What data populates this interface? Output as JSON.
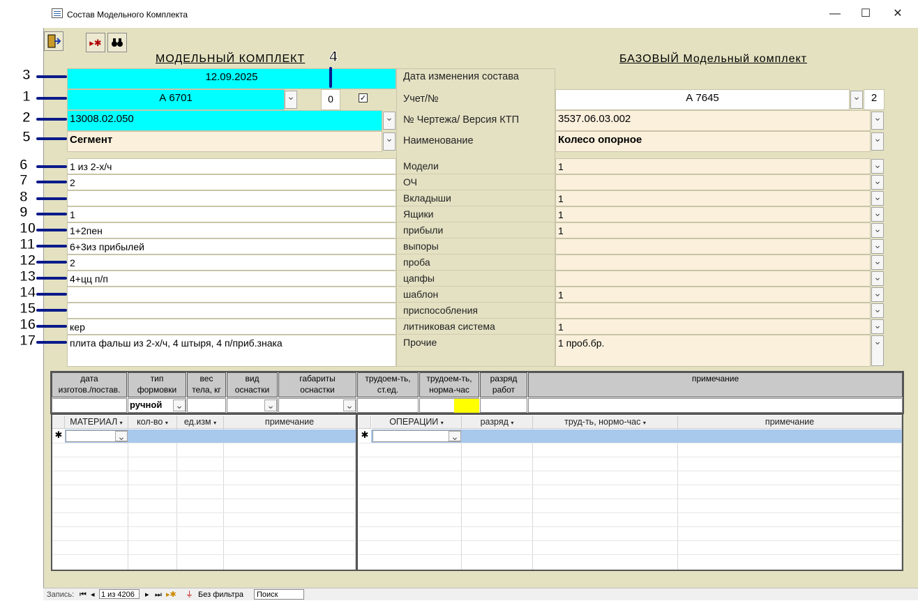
{
  "window": {
    "title": "Состав Модельного Комплекта",
    "minimize": "—",
    "maximize": "☐",
    "close": "✕"
  },
  "toolbar": {
    "exit_icon": "exit-door-icon",
    "new_icon": "new-record-icon",
    "find_icon": "binoculars-icon"
  },
  "headers": {
    "left": "МОДЕЛЬНЫЙ   КОМПЛЕКТ",
    "right": "БАЗОВЫЙ  Модельный комплект"
  },
  "left": {
    "date": "12.09.2025",
    "account": "А 6701",
    "count": "0",
    "drawing": "13008.02.050",
    "name": "Сегмент",
    "models": "1 из 2-х/ч",
    "och": "2",
    "inserts": "",
    "boxes": "1",
    "risers": "1+2пен",
    "vents": "6+3из прибылей",
    "sample": "2",
    "pins": "4+цц п/п",
    "template": "",
    "fixtures": "",
    "gating": "кер",
    "other": "плита фальш из 2-х/ч, 4 штыря, 4 п/приб.знака"
  },
  "labels": {
    "date": "Дата изменения состава",
    "account": "Учет/№",
    "drawing": "№  Чертежа/ Версия КТП",
    "name": "Наименование",
    "models": "Модели",
    "och": "ОЧ",
    "inserts": "Вкладыши",
    "boxes": "Ящики",
    "risers": "прибыли",
    "vents": "выпоры",
    "sample": "проба",
    "pins": "цапфы",
    "template": "шаблон",
    "fixtures": "приспособления",
    "gating": "литниковая система",
    "other": "Прочие"
  },
  "right": {
    "account": "А 7645",
    "account_num": "2",
    "drawing": "3537.06.03.002",
    "name": "Колесо опорное",
    "models": "1",
    "och": "",
    "inserts": "1",
    "boxes": "1",
    "risers": "1",
    "vents": "",
    "sample": "",
    "pins": "",
    "template": "1",
    "fixtures": "",
    "gating": "1",
    "other": "1 проб.бр."
  },
  "callouts": [
    "3",
    "1",
    "2",
    "5",
    "6",
    "7",
    "8",
    "9",
    "10",
    "11",
    "12",
    "13",
    "14",
    "15",
    "16",
    "17",
    "4"
  ],
  "grid": {
    "headers": [
      "дата\nизготов./постав.",
      "тип\nформовки",
      "вес\nтела, кг",
      "вид\nоснастки",
      "габариты\nоснастки",
      "трудоем-ть,\nст.ед.",
      "трудоем-ть,\nнорма-час",
      "разряд\nработ",
      "примечание"
    ],
    "form_type_value": "ручной"
  },
  "materials": {
    "headers": [
      "МАТЕРИАЛ",
      "кол-во",
      "ед.изм",
      "примечание"
    ],
    "new_row_marker": "✱"
  },
  "operations": {
    "headers": [
      "ОПЕРАЦИИ",
      "разряд",
      "труд-ть, нормо-час",
      "примечание"
    ],
    "new_row_marker": "✱"
  },
  "status": {
    "record_label": "Запись:",
    "record_pos": "1 из 4206",
    "filter": "Без фильтра",
    "search": "Поиск"
  },
  "colors": {
    "cyan": "#00ffff",
    "cream": "#faf0dc",
    "background": "#e3e1c0",
    "yellow": "#ffff00"
  }
}
